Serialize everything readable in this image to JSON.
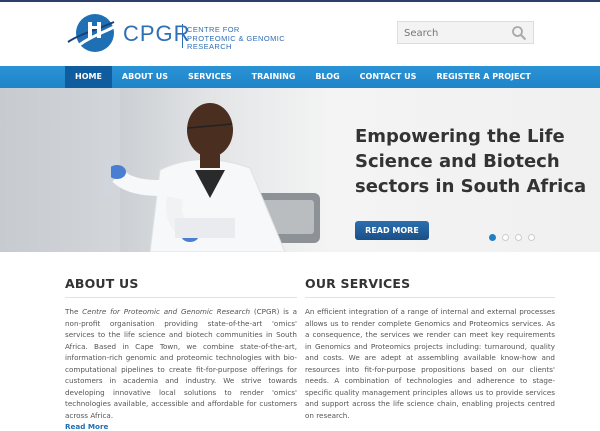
{
  "header": {
    "logo_word": "CPGR",
    "logo_tagline": "CENTRE FOR PROTEOMIC & GENOMIC RESEARCH",
    "search_placeholder": "Search"
  },
  "nav": {
    "items": [
      {
        "label": "HOME",
        "active": true
      },
      {
        "label": "ABOUT US",
        "active": false
      },
      {
        "label": "SERVICES",
        "active": false
      },
      {
        "label": "TRAINING",
        "active": false
      },
      {
        "label": "BLOG",
        "active": false
      },
      {
        "label": "CONTACT US",
        "active": false
      },
      {
        "label": "REGISTER A PROJECT",
        "active": false
      }
    ]
  },
  "hero": {
    "title": "Empowering the Life Science and Biotech sectors in South Africa",
    "button": "READ MORE",
    "slides": 4,
    "active_slide": 1
  },
  "about": {
    "title": "ABOUT US",
    "intro_prefix": "The ",
    "intro_em": "Centre for Proteomic and Genomic Research",
    "body": " (CPGR) is a non-profit organisation providing state-of-the-art 'omics' services to the life science and biotech communities in South Africa. Based in Cape Town, we combine state-of-the-art, information-rich genomic and proteomic technologies with bio-computational pipelines to create fit-for-purpose offerings for customers in academia and industry. We strive towards developing innovative local solutions to render 'omics' technologies available, accessible and affordable for customers across Africa.",
    "more": "Read More"
  },
  "services": {
    "title": "OUR SERVICES",
    "body": "An efficient integration of a range of internal and external processes allows us to render complete Genomics and Proteomics services. As a consequence, the services we render can meet key requirements in Genomics and Proteomics projects including: turnaround, quality and costs. We are adept at assembling available know-how and resources into fit-for-purpose propositions based on our clients' needs. A combination of technologies and adherence to stage-specific quality management principles allows us to provide services and support across the life science chain, enabling projects centred on research."
  },
  "colors": {
    "brand": "#2f6fb5",
    "nav": "#1f84c8",
    "nav_active": "#0f5d9e"
  }
}
